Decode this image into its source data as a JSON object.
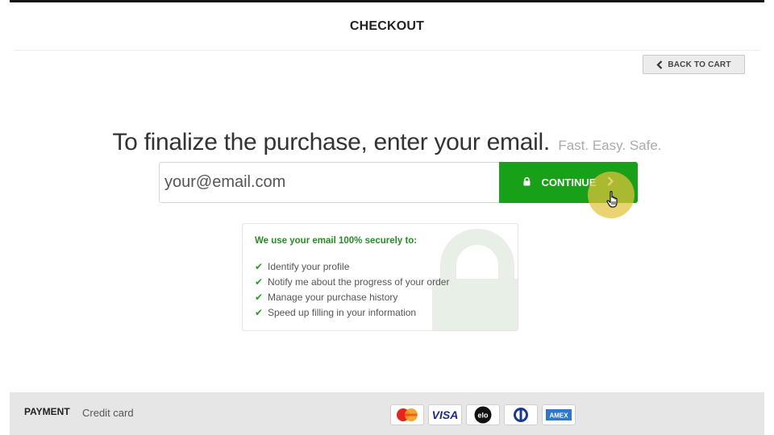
{
  "header": {
    "title": "CHECKOUT"
  },
  "back_button": {
    "label": "BACK TO CART"
  },
  "headline": {
    "main": "To finalize the purchase, enter your email.",
    "sub": "Fast. Easy. Safe."
  },
  "email": {
    "placeholder": "your@email.com",
    "value": ""
  },
  "continue_button": {
    "label": "CONTINUE"
  },
  "info": {
    "title": "We use your email 100% securely to:",
    "items": [
      "Identify your profile",
      "Notify me about the progress of your order",
      "Manage your purchase history",
      "Speed up filling in your information"
    ]
  },
  "footer": {
    "payment_label": "PAYMENT",
    "payment_method": "Credit card",
    "cards": [
      "mastercard-icon",
      "visa-icon",
      "elo-icon",
      "diners-icon",
      "amex-icon"
    ]
  },
  "colors": {
    "accent": "#18a118",
    "success_text": "#2a8a2a",
    "cursor_highlight": "#e2c43c"
  },
  "icons": {
    "back": "chevron-left-icon",
    "lock": "lock-icon",
    "next": "chevron-right-icon",
    "check": "check-icon"
  }
}
